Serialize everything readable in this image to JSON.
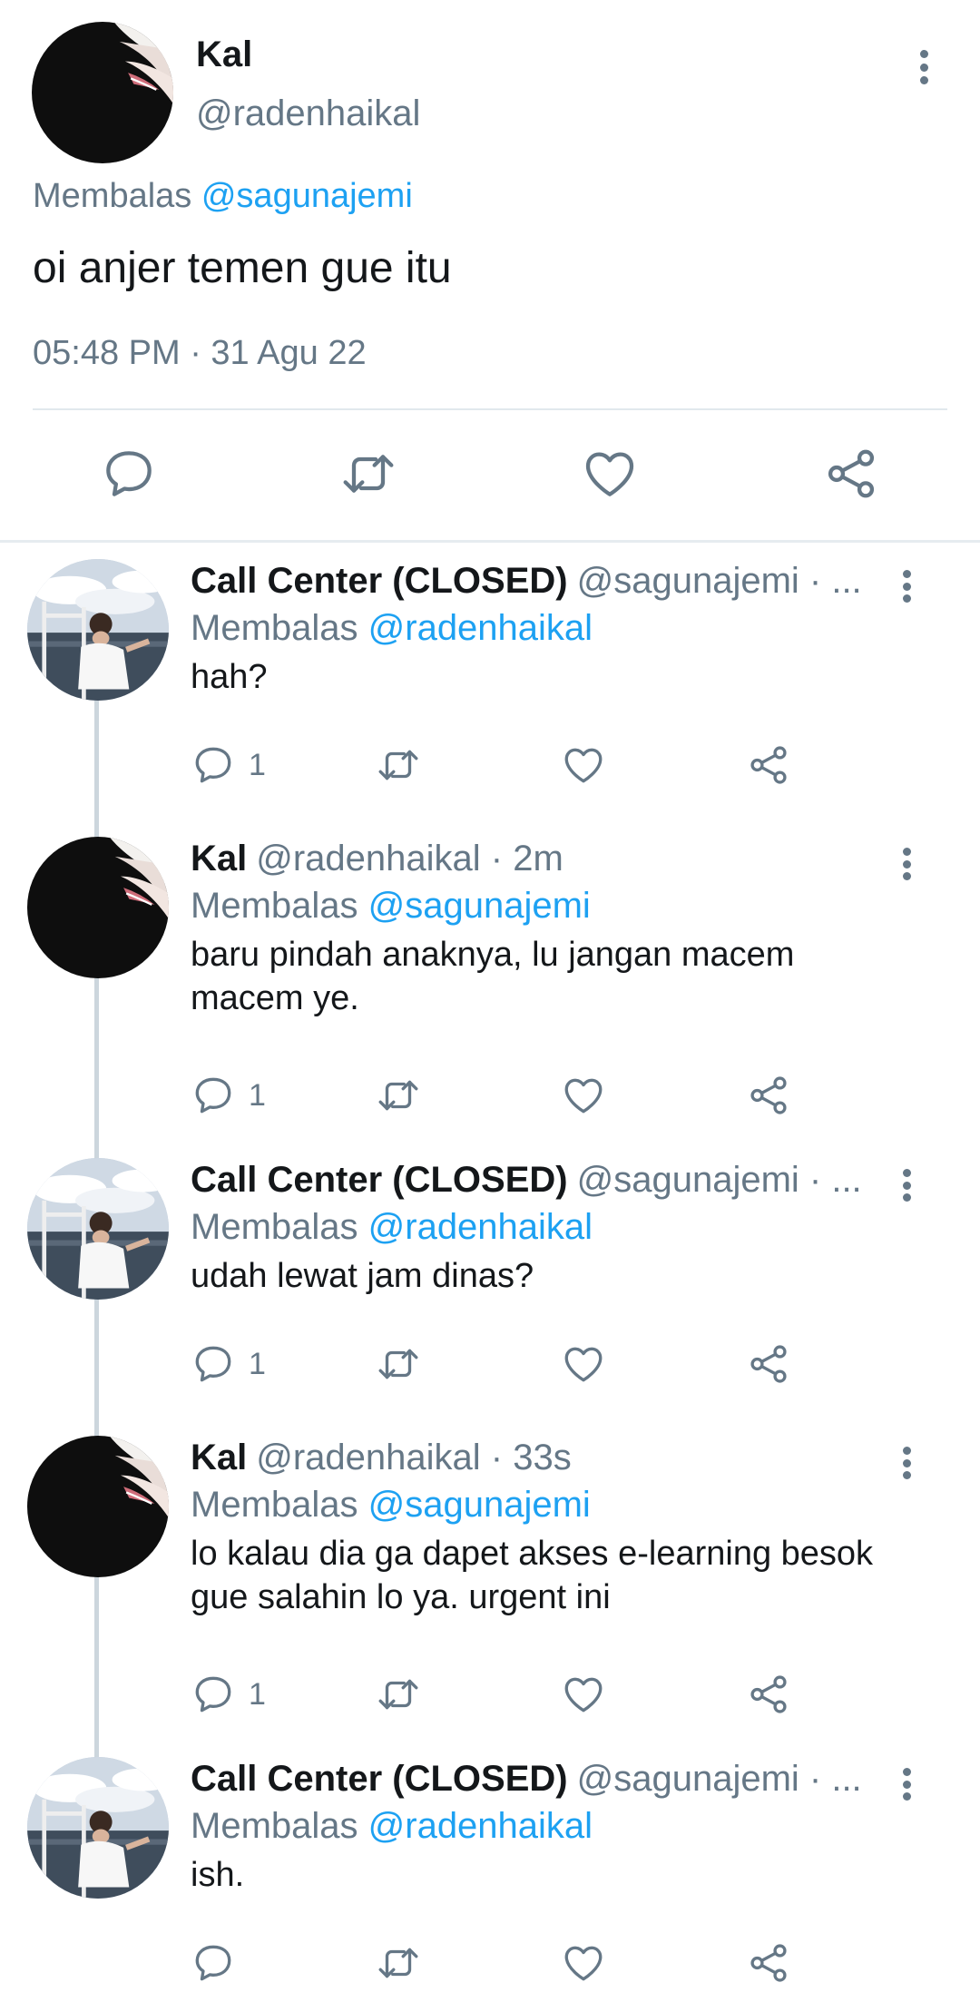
{
  "main_tweet": {
    "name": "Kal",
    "handle": "@radenhaikal",
    "reply_prefix": "Membalas",
    "reply_to": "@sagunajemi",
    "text": "oi anjer temen gue itu",
    "timestamp": "05:48 PM · 31 Agu 22",
    "actions": [
      "reply-icon",
      "retweet-icon",
      "like-icon",
      "share-icon"
    ]
  },
  "replies": [
    {
      "name": "Call Center (CLOSED)",
      "handle_meta": "@sagunajemi · ...",
      "reply_prefix": "Membalas",
      "reply_to": "@radenhaikal",
      "text": "hah?",
      "reply_count": "1",
      "avatar": "sea-photo-avatar"
    },
    {
      "name": "Kal",
      "handle_meta": "@radenhaikal · 2m",
      "reply_prefix": "Membalas",
      "reply_to": "@sagunajemi",
      "text": "baru pindah anaknya, lu jangan macem macem ye.",
      "reply_count": "1",
      "avatar": "dark-profile-avatar"
    },
    {
      "name": "Call Center (CLOSED)",
      "handle_meta": "@sagunajemi · ...",
      "reply_prefix": "Membalas",
      "reply_to": "@radenhaikal",
      "text": "udah lewat jam dinas?",
      "reply_count": "1",
      "avatar": "sea-photo-avatar"
    },
    {
      "name": "Kal",
      "handle_meta": "@radenhaikal · 33s",
      "reply_prefix": "Membalas",
      "reply_to": "@sagunajemi",
      "text": "lo kalau dia ga dapet akses e-learning besok gue salahin lo ya. urgent ini",
      "reply_count": "1",
      "avatar": "dark-profile-avatar"
    },
    {
      "name": "Call Center (CLOSED)",
      "handle_meta": "@sagunajemi · ...",
      "reply_prefix": "Membalas",
      "reply_to": "@radenhaikal",
      "text": "ish.",
      "reply_count": "",
      "avatar": "sea-photo-avatar"
    }
  ],
  "colors": {
    "text_primary": "#14171a",
    "text_secondary": "#657786",
    "mention": "#1da1f2",
    "divider": "#e1e8ed",
    "thread_line": "#ccd6dd"
  }
}
